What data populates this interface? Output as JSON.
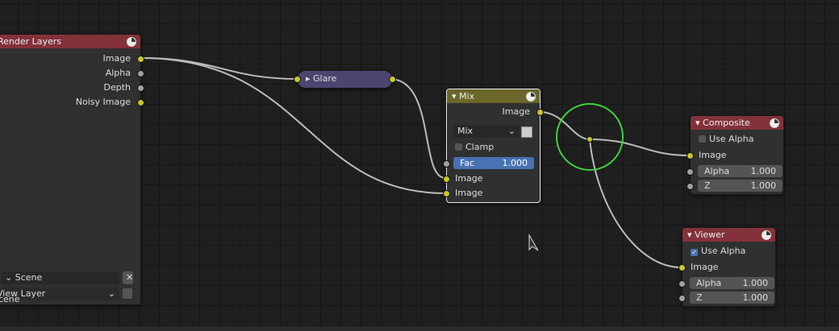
{
  "render_layers": {
    "title": "Render Layers",
    "outputs": [
      "Image",
      "Alpha",
      "Depth",
      "Noisy Image"
    ],
    "scene": "Scene",
    "layer": "View Layer",
    "overlap": "Scene"
  },
  "glare": {
    "title": "Glare"
  },
  "mix": {
    "title": "Mix",
    "output": "Image",
    "blend": "Mix",
    "clamp": "Clamp",
    "fac_label": "Fac",
    "fac_value": "1.000",
    "inputs": [
      "Image",
      "Image"
    ]
  },
  "composite": {
    "title": "Composite",
    "use_alpha": "Use Alpha",
    "image": "Image",
    "alpha_label": "Alpha",
    "alpha_value": "1.000",
    "z_label": "Z",
    "z_value": "1.000"
  },
  "viewer": {
    "title": "Viewer",
    "use_alpha": "Use Alpha",
    "image": "Image",
    "alpha_label": "Alpha",
    "alpha_value": "1.000",
    "z_label": "Z",
    "z_value": "1.000"
  },
  "colors": {
    "input_header": "#83313a",
    "filter_header": "#4b4670",
    "color_header": "#6b6629",
    "socket_color": "#c7c729",
    "highlight": "#3fd13f"
  }
}
